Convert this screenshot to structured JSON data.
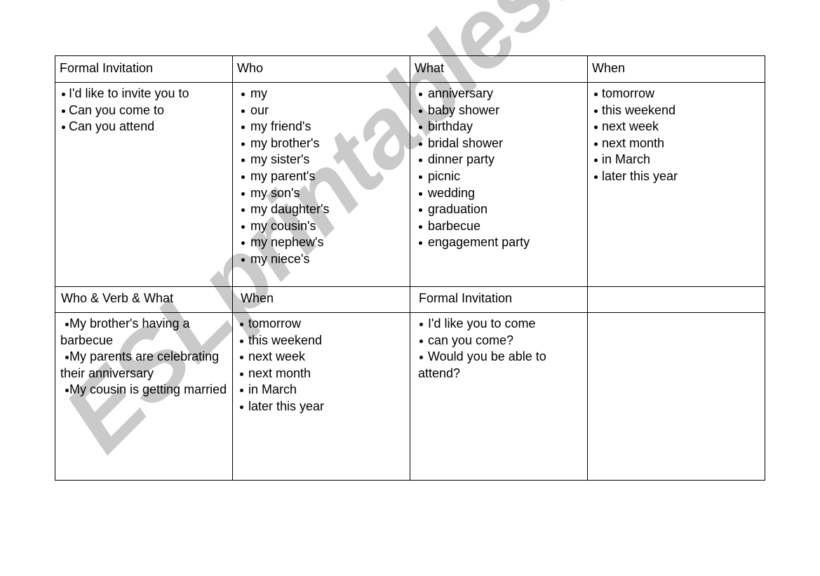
{
  "watermark": "ESLprintables.com",
  "table": {
    "section1": {
      "headers": [
        "Formal Invitation",
        "Who",
        "What",
        "When"
      ],
      "columns": [
        [
          "I'd like to invite you to",
          "Can you come to",
          "Can you attend"
        ],
        [
          "my",
          "our",
          "my friend's",
          "my brother's",
          "my sister's",
          "my parent's",
          "my son's",
          "my daughter's",
          "my cousin's",
          "my nephew's",
          "my niece's"
        ],
        [
          "anniversary",
          "baby shower",
          "birthday",
          "bridal shower",
          "dinner party",
          "picnic",
          "wedding",
          "graduation",
          "barbecue",
          "engagement party"
        ],
        [
          "tomorrow",
          "this weekend",
          "next week",
          "next month",
          "in March",
          "later this year"
        ]
      ]
    },
    "section2": {
      "headers": [
        "Who & Verb & What",
        "When",
        "Formal Invitation",
        ""
      ],
      "columns": [
        [
          "My brother's having a barbecue",
          "My parents are celebrating their anniversary",
          "My cousin is getting married"
        ],
        [
          "tomorrow",
          "this weekend",
          "next week",
          "next month",
          "in March",
          "later this year"
        ],
        [
          "I'd like you to come",
          "can you come?",
          "Would you be able to attend?"
        ],
        []
      ]
    }
  }
}
